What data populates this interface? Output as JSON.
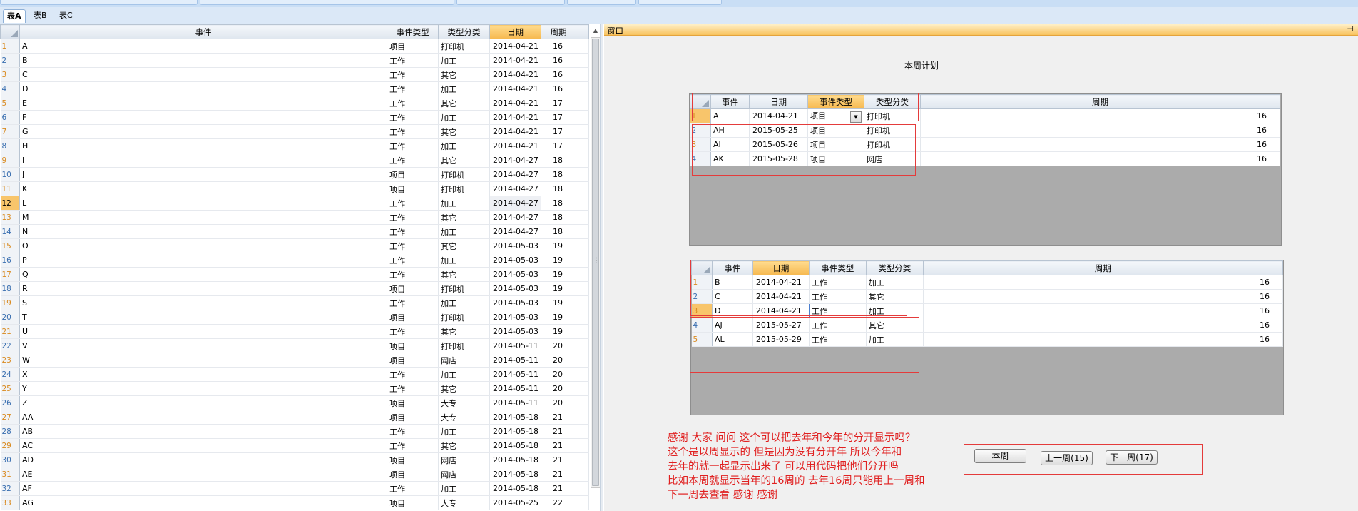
{
  "sheet_tabs": [
    "表A",
    "表B",
    "表C"
  ],
  "main_grid": {
    "columns": [
      "事件",
      "事件类型",
      "类型分类",
      "日期",
      "周期"
    ],
    "rows": [
      {
        "n": "1",
        "e": "A",
        "t": "项目",
        "c": "打印机",
        "d": "2014-04-21",
        "w": "16"
      },
      {
        "n": "2",
        "e": "B",
        "t": "工作",
        "c": "加工",
        "d": "2014-04-21",
        "w": "16"
      },
      {
        "n": "3",
        "e": "C",
        "t": "工作",
        "c": "其它",
        "d": "2014-04-21",
        "w": "16"
      },
      {
        "n": "4",
        "e": "D",
        "t": "工作",
        "c": "加工",
        "d": "2014-04-21",
        "w": "16"
      },
      {
        "n": "5",
        "e": "E",
        "t": "工作",
        "c": "其它",
        "d": "2014-04-21",
        "w": "17"
      },
      {
        "n": "6",
        "e": "F",
        "t": "工作",
        "c": "加工",
        "d": "2014-04-21",
        "w": "17"
      },
      {
        "n": "7",
        "e": "G",
        "t": "工作",
        "c": "其它",
        "d": "2014-04-21",
        "w": "17"
      },
      {
        "n": "8",
        "e": "H",
        "t": "工作",
        "c": "加工",
        "d": "2014-04-21",
        "w": "17"
      },
      {
        "n": "9",
        "e": "I",
        "t": "工作",
        "c": "其它",
        "d": "2014-04-27",
        "w": "18"
      },
      {
        "n": "10",
        "e": "J",
        "t": "项目",
        "c": "打印机",
        "d": "2014-04-27",
        "w": "18"
      },
      {
        "n": "11",
        "e": "K",
        "t": "项目",
        "c": "打印机",
        "d": "2014-04-27",
        "w": "18"
      },
      {
        "n": "12",
        "e": "L",
        "t": "工作",
        "c": "加工",
        "d": "2014-04-27",
        "w": "18"
      },
      {
        "n": "13",
        "e": "M",
        "t": "工作",
        "c": "其它",
        "d": "2014-04-27",
        "w": "18"
      },
      {
        "n": "14",
        "e": "N",
        "t": "工作",
        "c": "加工",
        "d": "2014-04-27",
        "w": "18"
      },
      {
        "n": "15",
        "e": "O",
        "t": "工作",
        "c": "其它",
        "d": "2014-05-03",
        "w": "19"
      },
      {
        "n": "16",
        "e": "P",
        "t": "工作",
        "c": "加工",
        "d": "2014-05-03",
        "w": "19"
      },
      {
        "n": "17",
        "e": "Q",
        "t": "工作",
        "c": "其它",
        "d": "2014-05-03",
        "w": "19"
      },
      {
        "n": "18",
        "e": "R",
        "t": "项目",
        "c": "打印机",
        "d": "2014-05-03",
        "w": "19"
      },
      {
        "n": "19",
        "e": "S",
        "t": "工作",
        "c": "加工",
        "d": "2014-05-03",
        "w": "19"
      },
      {
        "n": "20",
        "e": "T",
        "t": "项目",
        "c": "打印机",
        "d": "2014-05-03",
        "w": "19"
      },
      {
        "n": "21",
        "e": "U",
        "t": "工作",
        "c": "其它",
        "d": "2014-05-03",
        "w": "19"
      },
      {
        "n": "22",
        "e": "V",
        "t": "项目",
        "c": "打印机",
        "d": "2014-05-11",
        "w": "20"
      },
      {
        "n": "23",
        "e": "W",
        "t": "项目",
        "c": "网店",
        "d": "2014-05-11",
        "w": "20"
      },
      {
        "n": "24",
        "e": "X",
        "t": "工作",
        "c": "加工",
        "d": "2014-05-11",
        "w": "20"
      },
      {
        "n": "25",
        "e": "Y",
        "t": "工作",
        "c": "其它",
        "d": "2014-05-11",
        "w": "20"
      },
      {
        "n": "26",
        "e": "Z",
        "t": "项目",
        "c": "大专",
        "d": "2014-05-11",
        "w": "20"
      },
      {
        "n": "27",
        "e": "AA",
        "t": "项目",
        "c": "大专",
        "d": "2014-05-18",
        "w": "21"
      },
      {
        "n": "28",
        "e": "AB",
        "t": "工作",
        "c": "加工",
        "d": "2014-05-18",
        "w": "21"
      },
      {
        "n": "29",
        "e": "AC",
        "t": "工作",
        "c": "其它",
        "d": "2014-05-18",
        "w": "21"
      },
      {
        "n": "30",
        "e": "AD",
        "t": "项目",
        "c": "网店",
        "d": "2014-05-18",
        "w": "21"
      },
      {
        "n": "31",
        "e": "AE",
        "t": "项目",
        "c": "网店",
        "d": "2014-05-18",
        "w": "21"
      },
      {
        "n": "32",
        "e": "AF",
        "t": "工作",
        "c": "加工",
        "d": "2014-05-18",
        "w": "21"
      },
      {
        "n": "33",
        "e": "AG",
        "t": "项目",
        "c": "大专",
        "d": "2014-05-25",
        "w": "22"
      }
    ]
  },
  "window": {
    "title": "窗口",
    "pin_icon": "pin-icon",
    "plan_title": "本周计划"
  },
  "grid_project": {
    "columns": [
      "事件",
      "日期",
      "事件类型",
      "类型分类",
      "周期"
    ],
    "rows": [
      {
        "n": "1",
        "e": "A",
        "d": "2014-04-21",
        "t": "项目",
        "c": "打印机",
        "w": "16"
      },
      {
        "n": "2",
        "e": "AH",
        "d": "2015-05-25",
        "t": "项目",
        "c": "打印机",
        "w": "16"
      },
      {
        "n": "3",
        "e": "AI",
        "d": "2015-05-26",
        "t": "项目",
        "c": "打印机",
        "w": "16"
      },
      {
        "n": "4",
        "e": "AK",
        "d": "2015-05-28",
        "t": "项目",
        "c": "网店",
        "w": "16"
      }
    ]
  },
  "grid_work": {
    "columns": [
      "事件",
      "日期",
      "事件类型",
      "类型分类",
      "周期"
    ],
    "rows": [
      {
        "n": "1",
        "e": "B",
        "d": "2014-04-21",
        "t": "工作",
        "c": "加工",
        "w": "16"
      },
      {
        "n": "2",
        "e": "C",
        "d": "2014-04-21",
        "t": "工作",
        "c": "其它",
        "w": "16"
      },
      {
        "n": "3",
        "e": "D",
        "d": "2014-04-21",
        "t": "工作",
        "c": "加工",
        "w": "16"
      },
      {
        "n": "4",
        "e": "AJ",
        "d": "2015-05-27",
        "t": "工作",
        "c": "其它",
        "w": "16"
      },
      {
        "n": "5",
        "e": "AL",
        "d": "2015-05-29",
        "t": "工作",
        "c": "加工",
        "w": "16"
      }
    ]
  },
  "note_lines": [
    "感谢 大家 问问 这个可以把去年和今年的分开显示吗？",
    "这个是以周显示的 但是因为没有分开年 所以今年和",
    "去年的就一起显示出来了  可以用代码把他们分开吗",
    "比如本周就显示当年的16周的 去年16周只能用上一周和",
    "下一周去查看 感谢 感谢"
  ],
  "buttons": {
    "this_week": "本周",
    "prev_week": "上一周(15)",
    "next_week": "下一周(17)"
  },
  "colors": {
    "selected_header": "#f6b84f",
    "annotation_red": "#e43b3b",
    "row_number_blue": "#3a6fb0"
  }
}
